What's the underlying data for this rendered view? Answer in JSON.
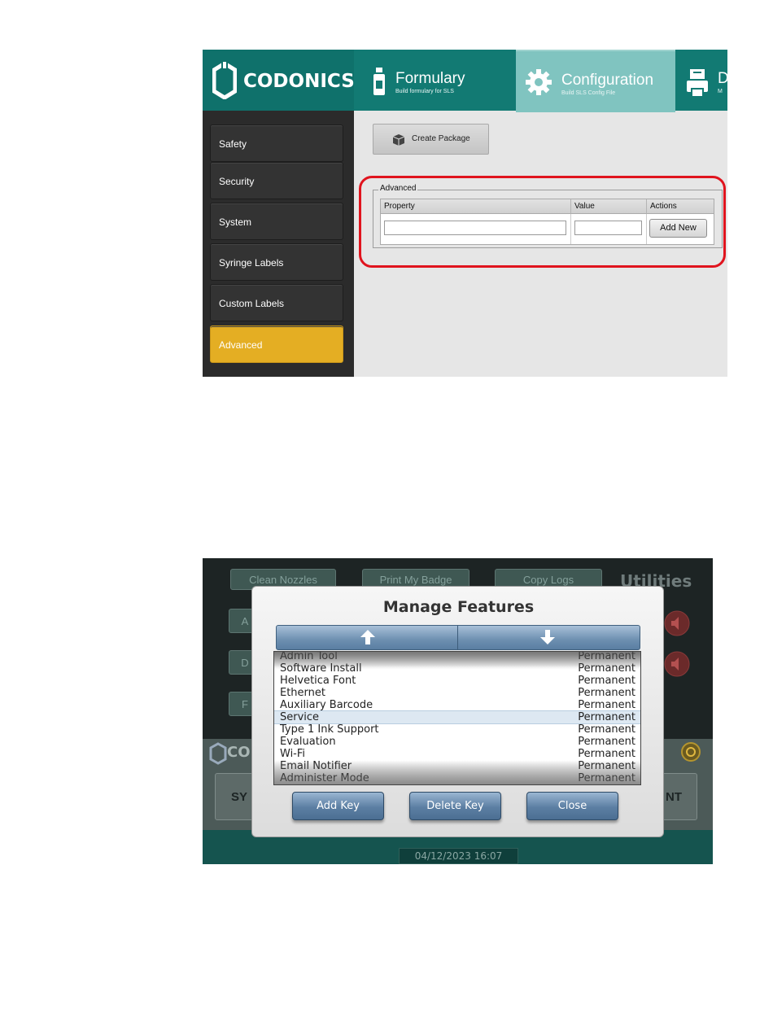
{
  "config_screen": {
    "logo_text": "CODONICS",
    "tabs": [
      {
        "name": "Formulary",
        "subtitle": "Build formulary for SLS",
        "icon": "bottle-icon"
      },
      {
        "name": "Configuration",
        "subtitle": "Build SLS Config File",
        "icon": "gear-icon",
        "active": true
      },
      {
        "name": "D",
        "subtitle": "M",
        "icon": "printer-icon"
      }
    ],
    "sidebar": [
      {
        "label": "Safety"
      },
      {
        "label": "Security"
      },
      {
        "label": "System"
      },
      {
        "label": "Syringe Labels"
      },
      {
        "label": "Custom Labels"
      },
      {
        "label": "Advanced",
        "active": true
      }
    ],
    "create_package_label": "Create Package",
    "advanced": {
      "legend": "Advanced",
      "columns": [
        "Property",
        "Value",
        "Actions"
      ],
      "property_value": "",
      "value_value": "",
      "add_new_label": "Add New"
    },
    "highlight_color": "#e0141e",
    "accent_color": "#127a73",
    "active_sidebar_color": "#e4ae23"
  },
  "utilities_screen": {
    "background_buttons": [
      "Clean Nozzles",
      "Print My Badge",
      "Copy Logs"
    ],
    "side_buttons": [
      "A",
      "D",
      "F"
    ],
    "title": "Utilities",
    "bottom_buttons": [
      "SY",
      "NT"
    ],
    "logo_fragment": "CO",
    "datetime": "04/12/2023 16:07",
    "dialog": {
      "title": "Manage Features",
      "features": [
        {
          "name": "Admin Tool",
          "status": "Permanent"
        },
        {
          "name": "Software Install",
          "status": "Permanent"
        },
        {
          "name": "Helvetica Font",
          "status": "Permanent"
        },
        {
          "name": "Ethernet",
          "status": "Permanent"
        },
        {
          "name": "Auxiliary Barcode",
          "status": "Permanent"
        },
        {
          "name": "Service",
          "status": "Permanent",
          "selected": true
        },
        {
          "name": "Type 1 Ink Support",
          "status": "Permanent"
        },
        {
          "name": "Evaluation",
          "status": "Permanent"
        },
        {
          "name": "Wi-Fi",
          "status": "Permanent"
        },
        {
          "name": "Email Notifier",
          "status": "Permanent"
        },
        {
          "name": "Administer Mode",
          "status": "Permanent"
        }
      ],
      "buttons": {
        "add_key": "Add Key",
        "delete_key": "Delete Key",
        "close": "Close"
      }
    }
  }
}
